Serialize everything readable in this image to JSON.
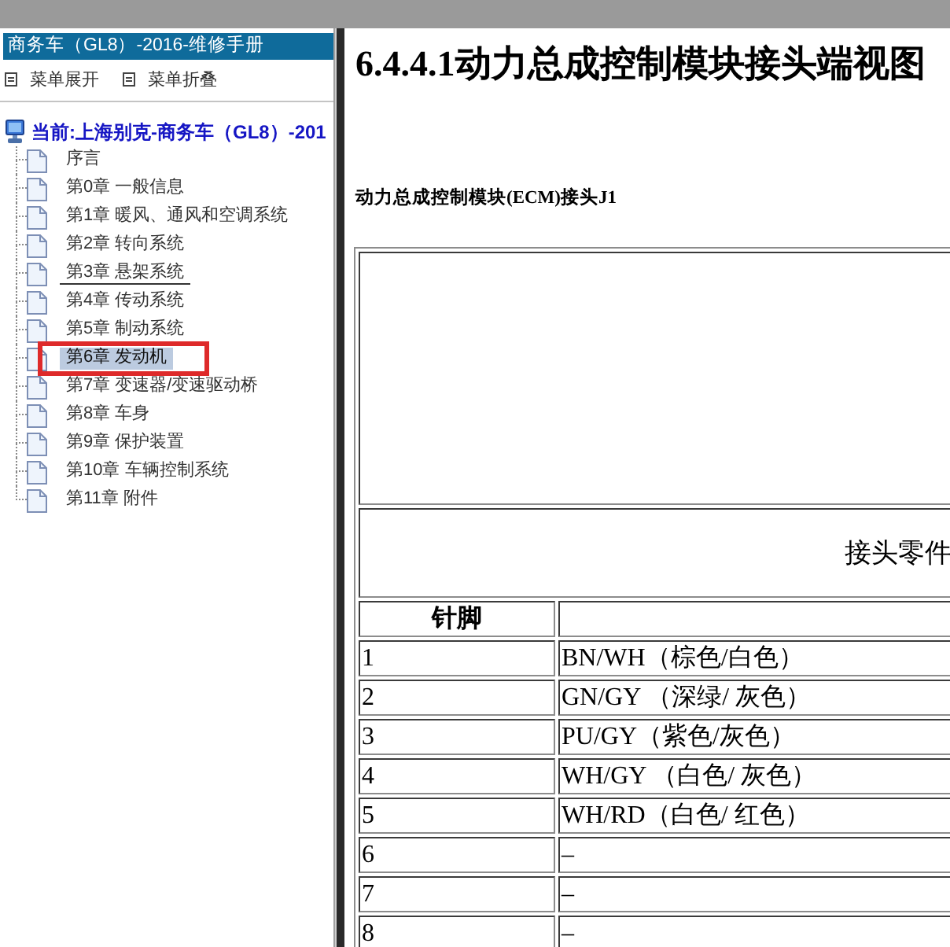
{
  "nav": {
    "title": "商务车（GL8）-2016-维修手册",
    "menu": [
      {
        "label": "菜单展开"
      },
      {
        "label": "菜单折叠"
      }
    ],
    "tree": {
      "label": "当前:上海别克-商务车（GL8）-201",
      "children": [
        {
          "label": "序言",
          "selected": false,
          "hovered": false,
          "marked": false
        },
        {
          "label": "第0章 一般信息",
          "selected": false,
          "hovered": false,
          "marked": false
        },
        {
          "label": "第1章 暖风、通风和空调系统",
          "selected": false,
          "hovered": false,
          "marked": false
        },
        {
          "label": "第2章 转向系统",
          "selected": false,
          "hovered": false,
          "marked": false
        },
        {
          "label": "第3章 悬架系统",
          "selected": false,
          "hovered": true,
          "marked": false
        },
        {
          "label": "第4章 传动系统",
          "selected": false,
          "hovered": false,
          "marked": false
        },
        {
          "label": "第5章 制动系统",
          "selected": false,
          "hovered": false,
          "marked": false
        },
        {
          "label": "第6章 发动机",
          "selected": true,
          "hovered": false,
          "marked": true
        },
        {
          "label": "第7章 变速器/变速驱动桥",
          "selected": false,
          "hovered": false,
          "marked": false
        },
        {
          "label": "第8章 车身",
          "selected": false,
          "hovered": false,
          "marked": false
        },
        {
          "label": "第9章 保护装置",
          "selected": false,
          "hovered": false,
          "marked": false
        },
        {
          "label": "第10章 车辆控制系统",
          "selected": false,
          "hovered": false,
          "marked": false
        },
        {
          "label": "第11章 附件",
          "selected": false,
          "hovered": false,
          "marked": false
        }
      ]
    }
  },
  "document": {
    "heading": "6.4.4.1动力总成控制模块接头端视图",
    "caption": "动力总成控制模块(ECM)接头J1",
    "table": {
      "section_title": "接头零件",
      "columns": [
        "针脚"
      ],
      "rows": [
        [
          "1",
          "BN/WH（棕色/白色）"
        ],
        [
          "2",
          "GN/GY （深绿/ 灰色）"
        ],
        [
          "3",
          "PU/GY（紫色/灰色）"
        ],
        [
          "4",
          "WH/GY （白色/ 灰色）"
        ],
        [
          "5",
          "WH/RD（白色/ 红色）"
        ],
        [
          "6",
          "–"
        ],
        [
          "7",
          "–"
        ],
        [
          "8",
          "–"
        ]
      ]
    }
  }
}
